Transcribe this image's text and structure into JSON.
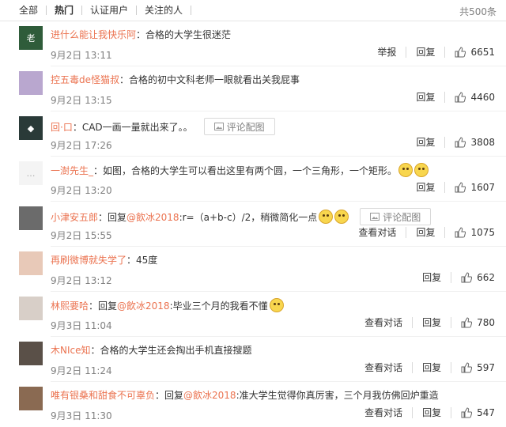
{
  "tabs": [
    "全部",
    "热门",
    "认证用户",
    "关注的人"
  ],
  "total": "共500条",
  "labels": {
    "report": "举报",
    "reply": "回复",
    "view": "查看对话",
    "pic": "评论配图"
  },
  "colors": {
    "username": "#eb7350",
    "muted": "#808080",
    "text": "#333333"
  },
  "comments": [
    {
      "user": "进什么能让我快乐阿",
      "text": "：合格的大学生很迷茫",
      "time": "9月2日 13:11",
      "likes": "6651"
    },
    {
      "user": "控五毒de怪猫叔",
      "text": "：合格的初中文科老师一眼就看出关我屁事",
      "time": "9月2日 13:15",
      "likes": "4460"
    },
    {
      "user": "回·口",
      "text": "：CAD一画一量就出来了。。",
      "time": "9月2日 17:26",
      "likes": "3808"
    },
    {
      "user": "一澍先生_",
      "text": "：如图，合格的大学生可以看出这里有两个圆，一个三角形，一个矩形。",
      "time": "9月2日 13:20",
      "likes": "1607"
    },
    {
      "user": "小津安五郎",
      "pre": "：回复",
      "mention": "@飲冰2018",
      "text": ":r=（a+b-c）/2，稍微简化一点",
      "time": "9月2日 15:55",
      "likes": "1075"
    },
    {
      "user": "再刷微博就失学了",
      "text": "：45度",
      "time": "9月2日 13:12",
      "likes": "662"
    },
    {
      "user": "林熙要哈",
      "pre": "：回复",
      "mention": "@飲冰2018",
      "text": ":毕业三个月的我看不懂",
      "time": "9月3日 11:04",
      "likes": "780"
    },
    {
      "user": "木NIce知",
      "text": "：合格的大学生还会掏出手机直接搜题",
      "time": "9月2日 11:24",
      "likes": "597"
    },
    {
      "user": "唯有银桑和甜食不可辜负",
      "pre": "：回复",
      "mention": "@飲冰2018",
      "text": ":准大学生觉得你真厉害，三个月我仿佛回炉重造",
      "time": "9月3日 11:30",
      "likes": "547"
    }
  ]
}
